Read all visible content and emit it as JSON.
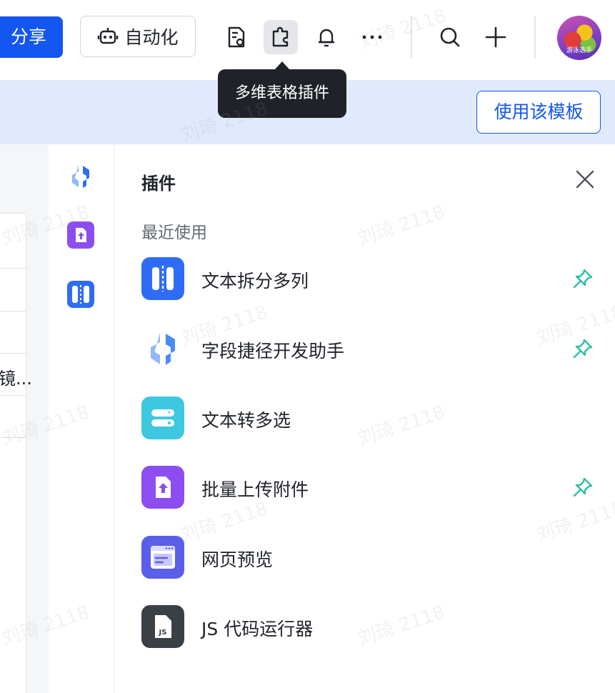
{
  "toolbar": {
    "share_label": "分享",
    "automation_label": "自动化",
    "icons": [
      "document-settings-icon",
      "plugin-icon",
      "bell-icon",
      "more-icon",
      "search-icon",
      "plus-icon"
    ],
    "avatar_text": "游泳选手"
  },
  "tooltip": {
    "text": "多维表格插件"
  },
  "banner": {
    "use_template_label": "使用该模板"
  },
  "left_area": {
    "cut_text": "镜..."
  },
  "panel": {
    "title": "插件",
    "section_label": "最近使用",
    "plugins": [
      {
        "label": "文本拆分多列",
        "icon": "split-columns-icon",
        "color": "#2f6cf6",
        "pinned": true
      },
      {
        "label": "字段捷径开发助手",
        "icon": "field-shortcut-icon",
        "color": "#4a8cf7",
        "pinned": true
      },
      {
        "label": "文本转多选",
        "icon": "text-to-multiselect-icon",
        "color": "#3ec7e0",
        "pinned": false
      },
      {
        "label": "批量上传附件",
        "icon": "upload-attachment-icon",
        "color": "#8c4ef0",
        "pinned": true
      },
      {
        "label": "网页预览",
        "icon": "web-preview-icon",
        "color": "#5b5ee8",
        "pinned": false
      },
      {
        "label": "JS 代码运行器",
        "icon": "js-runner-icon",
        "color": "#3b3f46",
        "pinned": false
      }
    ]
  },
  "watermark": "刘琦 2118",
  "colors": {
    "primary": "#1456f0",
    "banner": "#e1e9ff",
    "pin": "#2ebfa5",
    "tooltip": "#1f2329"
  }
}
